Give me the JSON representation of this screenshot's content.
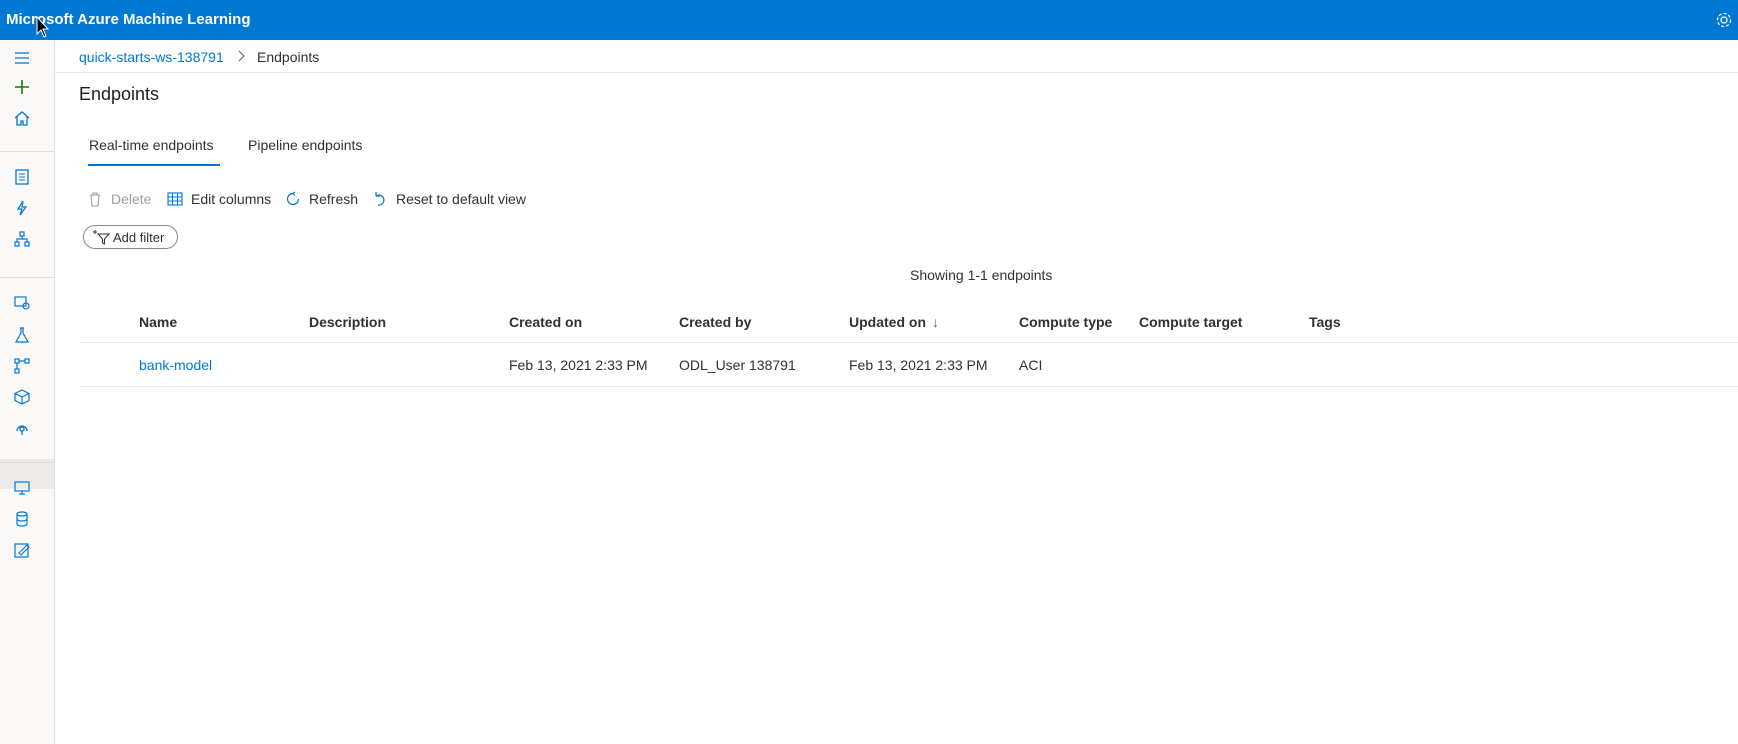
{
  "app": {
    "title": "Microsoft Azure Machine Learning"
  },
  "sidebar": {
    "items": [
      {
        "icon": "hamburger-icon"
      },
      {
        "icon": "plus-icon",
        "color": "#107c10"
      },
      {
        "icon": "home-icon"
      },
      {
        "icon": "notebook-icon"
      },
      {
        "icon": "automl-icon"
      },
      {
        "icon": "designer-icon"
      },
      {
        "icon": "datasets-icon"
      },
      {
        "icon": "experiments-icon"
      },
      {
        "icon": "pipelines-icon"
      },
      {
        "icon": "models-icon"
      },
      {
        "icon": "endpoints-icon",
        "active": true
      },
      {
        "icon": "compute-icon"
      },
      {
        "icon": "datastores-icon"
      },
      {
        "icon": "data-labeling-icon"
      }
    ]
  },
  "breadcrumb": {
    "workspace": "quick-starts-ws-138791",
    "current": "Endpoints"
  },
  "page": {
    "title": "Endpoints"
  },
  "tabs": [
    {
      "label": "Real-time endpoints",
      "selected": true
    },
    {
      "label": "Pipeline endpoints",
      "selected": false
    }
  ],
  "toolbar": {
    "delete_label": "Delete",
    "edit_columns_label": "Edit columns",
    "refresh_label": "Refresh",
    "reset_label": "Reset to default view"
  },
  "filter": {
    "add_label": "Add filter"
  },
  "table": {
    "showing": "Showing 1-1 endpoints",
    "columns": [
      "Name",
      "Description",
      "Created on",
      "Created by",
      "Updated on",
      "Compute type",
      "Compute target",
      "Tags"
    ],
    "sorted_column": "Updated on",
    "sort_icon": "↓",
    "rows": [
      {
        "name": "bank-model",
        "description": "",
        "created_on": "Feb 13, 2021 2:33 PM",
        "created_by": "ODL_User 138791",
        "updated_on": "Feb 13, 2021 2:33 PM",
        "compute_type": "ACI",
        "compute_target": "",
        "tags": ""
      }
    ]
  },
  "colors": {
    "accent": "#0078d4",
    "topbar": "#0078d4"
  }
}
